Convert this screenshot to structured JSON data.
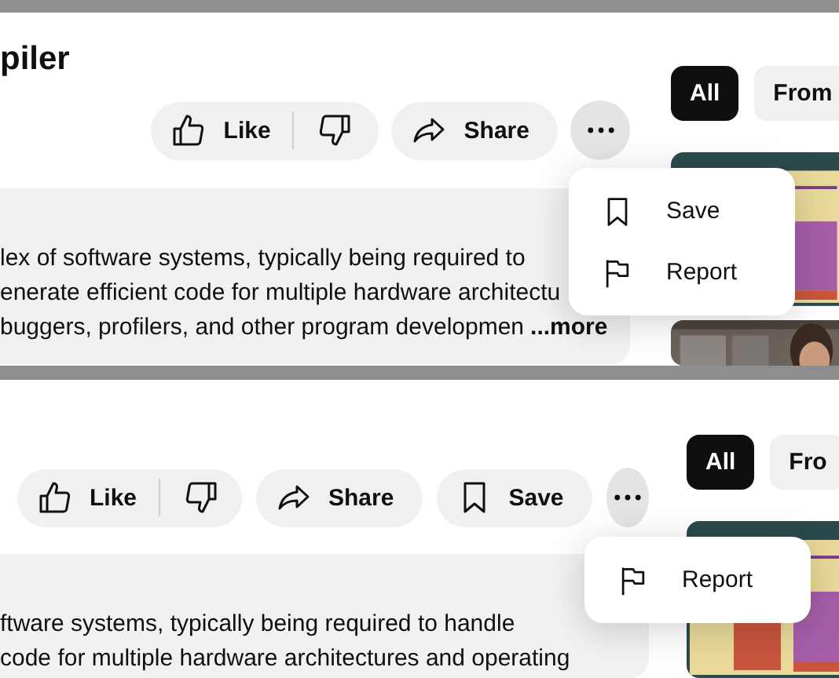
{
  "panels": [
    {
      "title": "piler",
      "actions": [
        {
          "kind": "like",
          "label": "Like"
        },
        {
          "kind": "share",
          "label": "Share"
        },
        {
          "kind": "more"
        }
      ],
      "description": {
        "lines": [
          "lex of software systems, typically being required to",
          "enerate efficient code for multiple hardware architectu",
          "buggers, profilers, and other program developmen"
        ],
        "more": "...more"
      },
      "menu": [
        {
          "kind": "save",
          "label": "Save"
        },
        {
          "kind": "report",
          "label": "Report"
        }
      ],
      "chips": [
        {
          "label": "All",
          "selected": true
        },
        {
          "label": "From",
          "selected": false
        }
      ],
      "thumbnails": [
        {
          "kind": "slide"
        },
        {
          "kind": "room"
        }
      ]
    },
    {
      "actions": [
        {
          "kind": "like",
          "label": "Like"
        },
        {
          "kind": "share",
          "label": "Share"
        },
        {
          "kind": "save",
          "label": "Save"
        },
        {
          "kind": "more"
        }
      ],
      "description": {
        "lines": [
          "ftware systems, typically being required to handle",
          "code for multiple hardware architectures and operating"
        ]
      },
      "menu": [
        {
          "kind": "report",
          "label": "Report"
        }
      ],
      "chips": [
        {
          "label": "All",
          "selected": true
        },
        {
          "label": "Fro",
          "selected": false
        }
      ],
      "thumbnails": [
        {
          "kind": "slide"
        }
      ]
    }
  ]
}
